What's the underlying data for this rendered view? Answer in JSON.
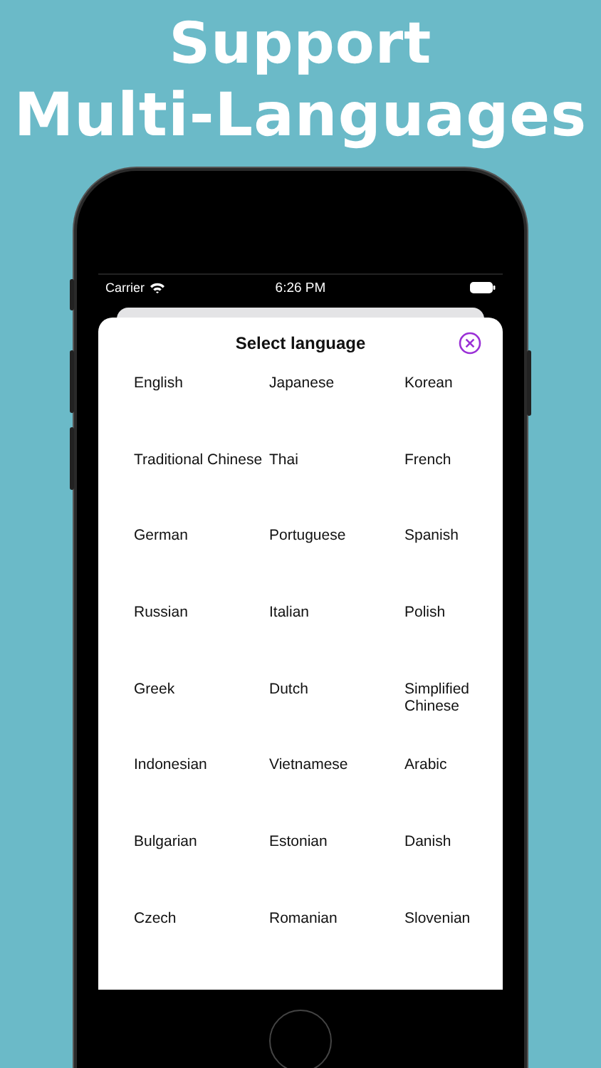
{
  "headline": [
    "Support",
    "Multi-Languages"
  ],
  "status_bar": {
    "carrier": "Carrier",
    "time": "6:26 PM"
  },
  "sheet": {
    "title": "Select language",
    "languages": [
      "English",
      "Japanese",
      "Korean",
      "Traditional Chinese",
      "Thai",
      "French",
      "German",
      "Portuguese",
      "Spanish",
      "Russian",
      "Italian",
      "Polish",
      "Greek",
      "Dutch",
      "Simplified Chinese",
      "Indonesian",
      "Vietnamese",
      "Arabic",
      "Bulgarian",
      "Estonian",
      "Danish",
      "Czech",
      "Romanian",
      "Slovenian"
    ]
  }
}
